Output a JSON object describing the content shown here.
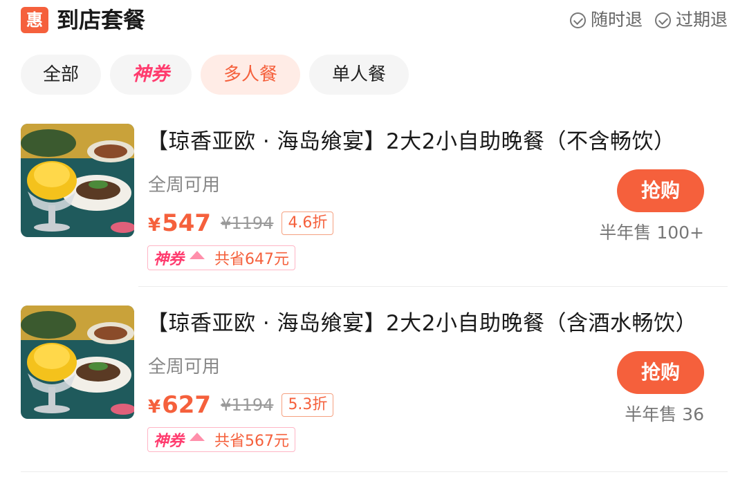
{
  "header": {
    "badge": "惠",
    "title": "到店套餐",
    "guarantees": [
      "随时退",
      "过期退"
    ]
  },
  "chips": [
    "全部",
    "神券",
    "多人餐",
    "单人餐"
  ],
  "products": [
    {
      "title": "【琼香亚欧 · 海岛飨宴】2大2小自助晚餐（不含畅饮）",
      "subtitle": "全周可用",
      "price": "547",
      "currency": "¥",
      "old_price": "¥1194",
      "discount": "4.6折",
      "voucher": "神券",
      "saving": "共省647元",
      "buy_label": "抢购",
      "sold": "半年售 100+"
    },
    {
      "title": "【琼香亚欧 · 海岛飨宴】2大2小自助晚餐（含酒水畅饮）",
      "subtitle": "全周可用",
      "price": "627",
      "currency": "¥",
      "old_price": "¥1194",
      "discount": "5.3折",
      "voucher": "神券",
      "saving": "共省567元",
      "buy_label": "抢购",
      "sold": "半年售 36"
    }
  ],
  "colors": {
    "accent": "#f5603c",
    "voucher_pink": "#ff3b6e"
  }
}
